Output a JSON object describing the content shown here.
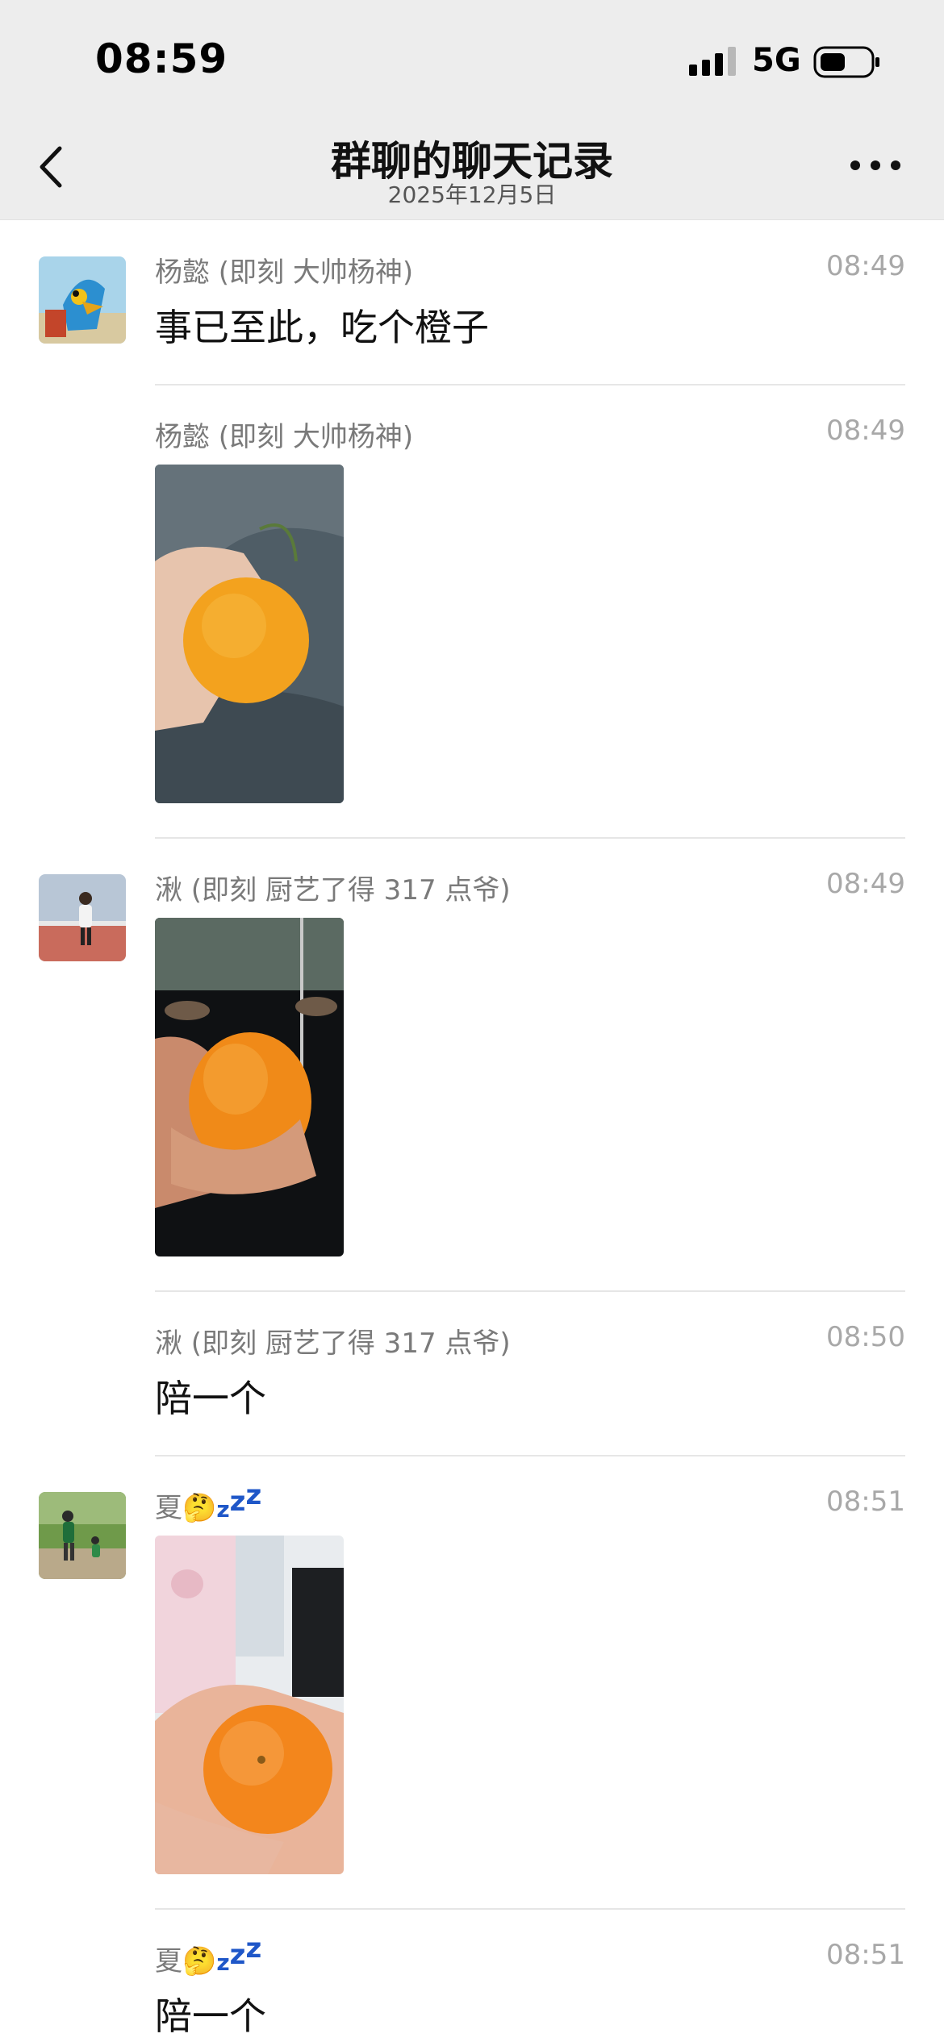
{
  "status": {
    "time": "08:59",
    "network": "5G"
  },
  "header": {
    "title": "群聊的聊天记录",
    "subtitle": "2025年12月5日",
    "back_icon": "chevron-left-icon",
    "more_icon": "more-dots-icon"
  },
  "messages": [
    {
      "sender": "杨懿 (即刻 大帅杨神)",
      "time": "08:49",
      "text": "事已至此，吃个橙子"
    },
    {
      "sender": "杨懿 (即刻 大帅杨神)",
      "time": "08:49"
    },
    {
      "sender": "湫 (即刻 厨艺了得 317 点爷)",
      "time": "08:49"
    },
    {
      "sender": "湫 (即刻 厨艺了得 317 点爷)",
      "time": "08:50",
      "text": "陪一个"
    },
    {
      "sender": "夏🤔",
      "time": "08:51"
    },
    {
      "sender": "夏🤔",
      "time": "08:51",
      "text": "陪一个"
    }
  ],
  "colors": {
    "header_bg": "#ededed",
    "accent_zz": "#1f57c8",
    "orange": "#f59a14"
  }
}
